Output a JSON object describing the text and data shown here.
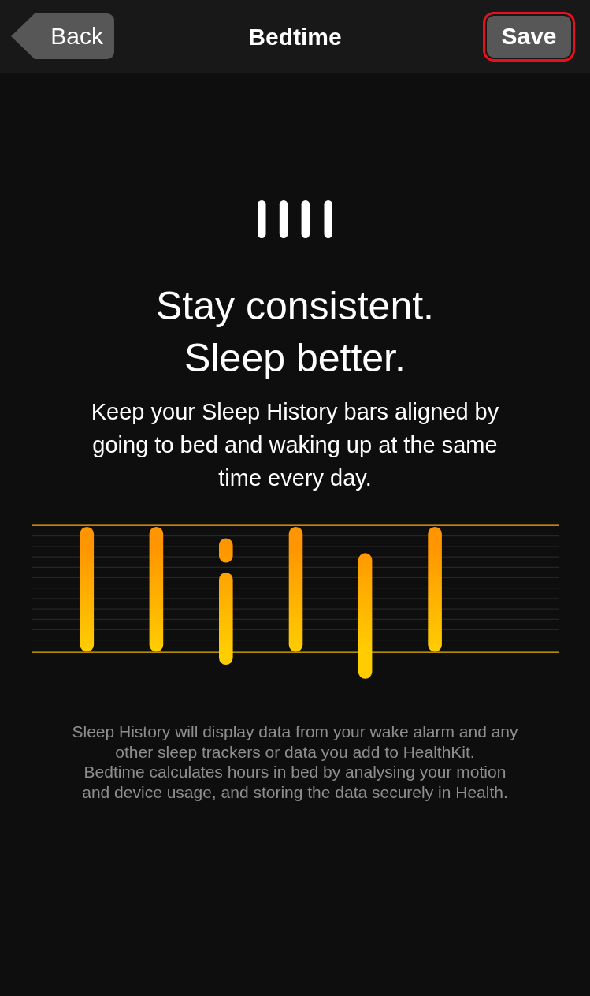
{
  "nav_bar": {
    "back_button": "Back",
    "title": "Bedtime",
    "save_button": {
      "label": "Save",
      "highlighted": true
    }
  },
  "headline": [
    "Stay consistent.",
    "Sleep better."
  ],
  "description": "Keep your Sleep History bars aligned by going to bed and waking up at the same time every day.",
  "footnote": [
    "Sleep History will display data from your wake alarm and any other sleep trackers or data you add to HealthKit.",
    "Bedtime calculates hours in bed by analysing your motion and device usage, and storing the data securely in Health."
  ]
}
